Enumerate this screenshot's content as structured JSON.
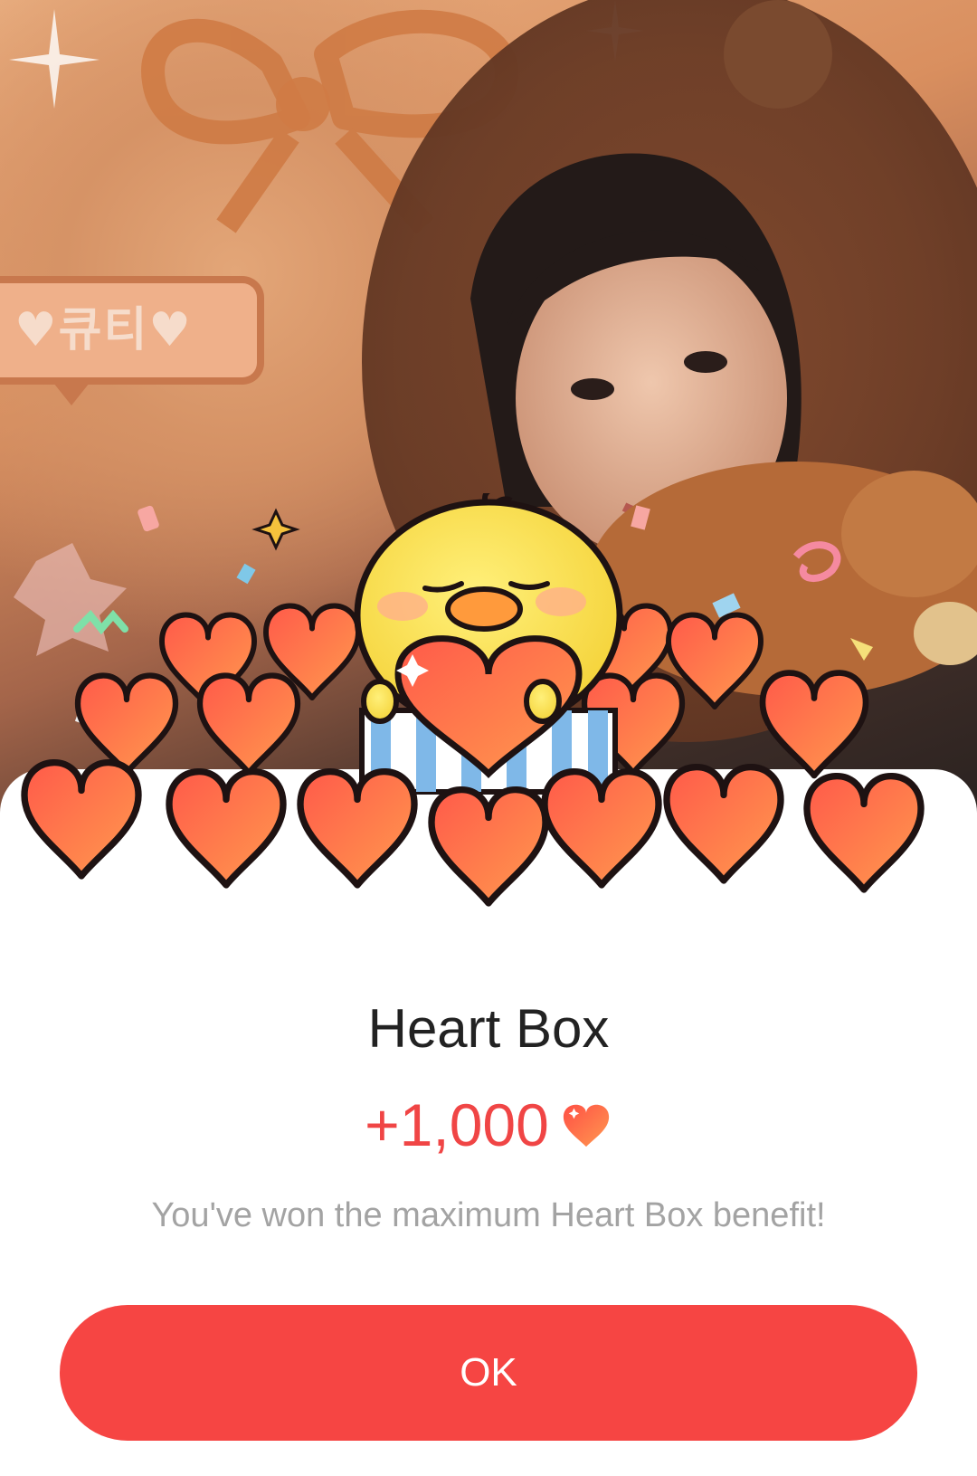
{
  "background": {
    "sticker_text": "♥큐티♥"
  },
  "dialog": {
    "title": "Heart Box",
    "reward_amount": "+1,000",
    "message": "You've won the maximum Heart Box benefit!",
    "ok_label": "OK"
  },
  "colors": {
    "accent": "#f64543",
    "reward_text": "#f04545",
    "message_text": "#a3a3a3",
    "title_text": "#222222"
  },
  "icons": {
    "reward": "heart-icon",
    "mascot": "chick-mascot"
  }
}
